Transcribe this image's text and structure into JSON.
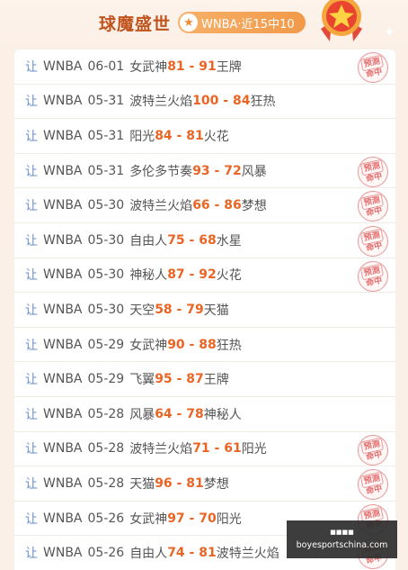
{
  "header": {
    "title": "球魔盛世",
    "badge_text": "WNBA·近15中10"
  },
  "rows": [
    {
      "prefix": "让",
      "league": "WNBA",
      "date": "06-01",
      "home": "女武神",
      "home_score": "81",
      "away_score": "91",
      "away": "王牌",
      "hit": true
    },
    {
      "prefix": "让",
      "league": "WNBA",
      "date": "05-31",
      "home": "波特兰火焰",
      "home_score": "100",
      "away_score": "84",
      "away": "狂热",
      "hit": false
    },
    {
      "prefix": "让",
      "league": "WNBA",
      "date": "05-31",
      "home": "阳光",
      "home_score": "84",
      "away_score": "81",
      "away": "火花",
      "hit": false
    },
    {
      "prefix": "让",
      "league": "WNBA",
      "date": "05-31",
      "home": "多伦多节奏",
      "home_score": "93",
      "away_score": "72",
      "away": "风暴",
      "hit": true
    },
    {
      "prefix": "让",
      "league": "WNBA",
      "date": "05-30",
      "home": "波特兰火焰",
      "home_score": "66",
      "away_score": "86",
      "away": "梦想",
      "hit": true
    },
    {
      "prefix": "让",
      "league": "WNBA",
      "date": "05-30",
      "home": "自由人",
      "home_score": "75",
      "away_score": "68",
      "away": "水星",
      "hit": true
    },
    {
      "prefix": "让",
      "league": "WNBA",
      "date": "05-30",
      "home": "神秘人",
      "home_score": "87",
      "away_score": "92",
      "away": "火花",
      "hit": true
    },
    {
      "prefix": "让",
      "league": "WNBA",
      "date": "05-30",
      "home": "天空",
      "home_score": "58",
      "away_score": "79",
      "away": "天猫",
      "hit": false
    },
    {
      "prefix": "让",
      "league": "WNBA",
      "date": "05-29",
      "home": "女武神",
      "home_score": "90",
      "away_score": "88",
      "away": "狂热",
      "hit": false
    },
    {
      "prefix": "让",
      "league": "WNBA",
      "date": "05-29",
      "home": "飞翼",
      "home_score": "95",
      "away_score": "87",
      "away": "王牌",
      "hit": false
    },
    {
      "prefix": "让",
      "league": "WNBA",
      "date": "05-28",
      "home": "风暴",
      "home_score": "64",
      "away_score": "78",
      "away": "神秘人",
      "hit": false
    },
    {
      "prefix": "让",
      "league": "WNBA",
      "date": "05-28",
      "home": "波特兰火焰",
      "home_score": "71",
      "away_score": "61",
      "away": "阳光",
      "hit": true
    },
    {
      "prefix": "让",
      "league": "WNBA",
      "date": "05-28",
      "home": "天猫",
      "home_score": "96",
      "away_score": "81",
      "away": "梦想",
      "hit": true
    },
    {
      "prefix": "让",
      "league": "WNBA",
      "date": "05-26",
      "home": "女武神",
      "home_score": "97",
      "away_score": "70",
      "away": "阳光",
      "hit": true
    },
    {
      "prefix": "让",
      "league": "WNBA",
      "date": "05-26",
      "home": "自由人",
      "home_score": "74",
      "away_score": "81",
      "away": "波特兰火焰",
      "hit": true
    }
  ],
  "stamp": {
    "line1": "预测",
    "line2": "命中"
  },
  "watermark": {
    "top": "■■■■",
    "url": "boyesportschina.com"
  },
  "colors": {
    "score": "#ea6424",
    "prefix": "#6a8ec7",
    "title": "#c1531d",
    "badge": "#f2994a",
    "stamp": "#e36c6c"
  }
}
